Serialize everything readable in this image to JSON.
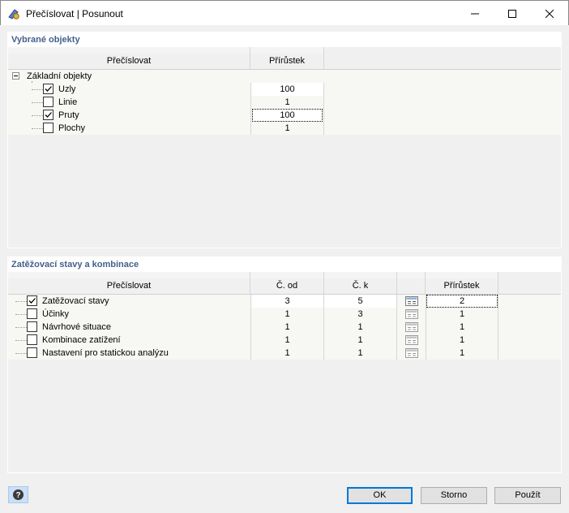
{
  "window": {
    "title": "Přečíslovat | Posunout"
  },
  "section1": {
    "title": "Vybrané objekty",
    "columns": {
      "renumber": "Přečíslovat",
      "increment": "Přírůstek"
    },
    "group": {
      "label": "Základní objekty",
      "expander": "−"
    },
    "rows": [
      {
        "label": "Uzly",
        "checked": true,
        "increment": "100"
      },
      {
        "label": "Linie",
        "checked": false,
        "increment": "1"
      },
      {
        "label": "Pruty",
        "checked": true,
        "increment": "100"
      },
      {
        "label": "Plochy",
        "checked": false,
        "increment": "1"
      }
    ]
  },
  "section2": {
    "title": "Zatěžovací stavy a kombinace",
    "columns": {
      "renumber": "Přečíslovat",
      "from": "Č. od",
      "to": "Č. k",
      "increment": "Přírůstek"
    },
    "rows": [
      {
        "label": "Zatěžovací stavy",
        "checked": true,
        "from": "3",
        "to": "5",
        "increment": "2"
      },
      {
        "label": "Účinky",
        "checked": false,
        "from": "1",
        "to": "3",
        "increment": "1"
      },
      {
        "label": "Návrhové situace",
        "checked": false,
        "from": "1",
        "to": "1",
        "increment": "1"
      },
      {
        "label": "Kombinace zatížení",
        "checked": false,
        "from": "1",
        "to": "1",
        "increment": "1"
      },
      {
        "label": "Nastavení pro statickou analýzu",
        "checked": false,
        "from": "1",
        "to": "1",
        "increment": "1"
      }
    ]
  },
  "buttons": {
    "ok": "OK",
    "cancel": "Storno",
    "apply": "Použít"
  },
  "icons": {
    "app": "renumber-app-icon",
    "help": "help-icon",
    "list": "list-select-icon"
  }
}
